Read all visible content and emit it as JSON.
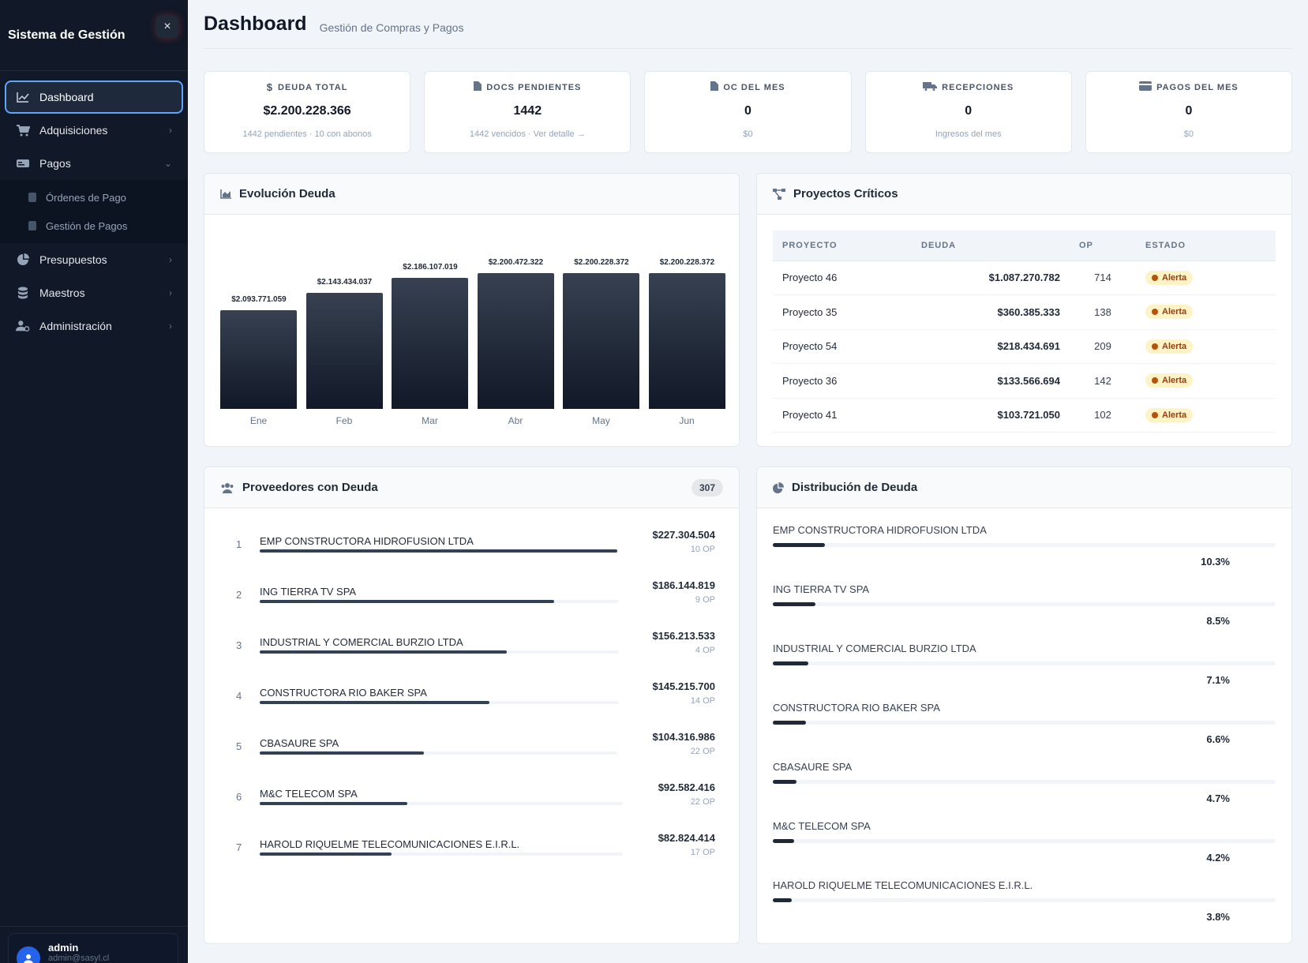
{
  "sidebar": {
    "title": "Sistema de Gestión",
    "close_icon": "×",
    "items": [
      {
        "label": "Dashboard",
        "icon": "chart-line-icon",
        "active": true
      },
      {
        "label": "Adquisiciones",
        "icon": "cart-icon"
      },
      {
        "label": "Pagos",
        "icon": "money-icon",
        "expanded": true
      },
      {
        "label": "Presupuestos",
        "icon": "pie-icon"
      },
      {
        "label": "Maestros",
        "icon": "database-icon"
      },
      {
        "label": "Administración",
        "icon": "user-cog-icon"
      }
    ],
    "sub_items": [
      {
        "label": "Órdenes de Pago"
      },
      {
        "label": "Gestión de Pagos"
      }
    ],
    "user": {
      "name": "admin",
      "email": "admin@sasyl.cl"
    }
  },
  "header": {
    "title": "Dashboard",
    "subtitle": "Gestión de Compras y Pagos"
  },
  "kpis": [
    {
      "label": "DEUDA TOTAL",
      "value": "$2.200.228.366",
      "note": "1442 pendientes · 10 con abonos",
      "icon": "dollar-icon"
    },
    {
      "label": "DOCS PENDIENTES",
      "value": "1442",
      "note": "1442 vencidos · Ver detalle →",
      "icon": "file-icon"
    },
    {
      "label": "OC DEL MES",
      "value": "0",
      "note": "$0",
      "icon": "file-icon"
    },
    {
      "label": "RECEPCIONES",
      "value": "0",
      "note": "Ingresos del mes",
      "icon": "truck-icon"
    },
    {
      "label": "PAGOS DEL MES",
      "value": "0",
      "note": "$0",
      "icon": "card-icon"
    }
  ],
  "evolucion": {
    "title": "Evolución Deuda",
    "chart_data": {
      "type": "bar",
      "categories": [
        "Ene",
        "Feb",
        "Mar",
        "Abr",
        "May",
        "Jun"
      ],
      "values": [
        2093771059,
        2143434037,
        2186107019,
        2200472322,
        2200228372,
        2200228372
      ],
      "value_labels": [
        "$2.093.771.059",
        "$2.143.434.037",
        "$2.186.107.019",
        "$2.200.472.322",
        "$2.200.228.372",
        "$2.200.228.372"
      ],
      "title": "Evolución Deuda"
    }
  },
  "criticos": {
    "title": "Proyectos Críticos",
    "columns": [
      "PROYECTO",
      "DEUDA",
      "OP",
      "ESTADO"
    ],
    "rows": [
      {
        "proyecto": "Proyecto 46",
        "deuda": "$1.087.270.782",
        "op": "714",
        "estado": "Alerta"
      },
      {
        "proyecto": "Proyecto 35",
        "deuda": "$360.385.333",
        "op": "138",
        "estado": "Alerta"
      },
      {
        "proyecto": "Proyecto 54",
        "deuda": "$218.434.691",
        "op": "209",
        "estado": "Alerta"
      },
      {
        "proyecto": "Proyecto 36",
        "deuda": "$133.566.694",
        "op": "142",
        "estado": "Alerta"
      },
      {
        "proyecto": "Proyecto 41",
        "deuda": "$103.721.050",
        "op": "102",
        "estado": "Alerta"
      }
    ]
  },
  "proveedores": {
    "title": "Proveedores con Deuda",
    "count": "307",
    "items": [
      {
        "rank": "1",
        "name": "EMP CONSTRUCTORA HIDROFUSION LTDA",
        "amount": "$227.304.504",
        "op": "10 OP",
        "ratio": 1.0
      },
      {
        "rank": "2",
        "name": "ING TIERRA TV SPA",
        "amount": "$186.144.819",
        "op": "9 OP",
        "ratio": 0.819
      },
      {
        "rank": "3",
        "name": "INDUSTRIAL Y COMERCIAL BURZIO LTDA",
        "amount": "$156.213.533",
        "op": "4 OP",
        "ratio": 0.687
      },
      {
        "rank": "4",
        "name": "CONSTRUCTORA RIO BAKER SPA",
        "amount": "$145.215.700",
        "op": "14 OP",
        "ratio": 0.639
      },
      {
        "rank": "5",
        "name": "CBASAURE SPA",
        "amount": "$104.316.986",
        "op": "22 OP",
        "ratio": 0.459
      },
      {
        "rank": "6",
        "name": "M&C TELECOM SPA",
        "amount": "$92.582.416",
        "op": "22 OP",
        "ratio": 0.407
      },
      {
        "rank": "7",
        "name": "HAROLD RIQUELME TELECOMUNICACIONES E.I.R.L.",
        "amount": "$82.824.414",
        "op": "17 OP",
        "ratio": 0.364
      }
    ]
  },
  "distribucion": {
    "title": "Distribución de Deuda",
    "items": [
      {
        "name": "EMP CONSTRUCTORA HIDROFUSION LTDA",
        "pct": "10.3%",
        "value": 10.3
      },
      {
        "name": "ING TIERRA TV SPA",
        "pct": "8.5%",
        "value": 8.5
      },
      {
        "name": "INDUSTRIAL Y COMERCIAL BURZIO LTDA",
        "pct": "7.1%",
        "value": 7.1
      },
      {
        "name": "CONSTRUCTORA RIO BAKER SPA",
        "pct": "6.6%",
        "value": 6.6
      },
      {
        "name": "CBASAURE SPA",
        "pct": "4.7%",
        "value": 4.7
      },
      {
        "name": "M&C TELECOM SPA",
        "pct": "4.2%",
        "value": 4.2
      },
      {
        "name": "HAROLD RIQUELME TELECOMUNICACIONES E.I.R.L.",
        "pct": "3.8%",
        "value": 3.8
      }
    ]
  }
}
